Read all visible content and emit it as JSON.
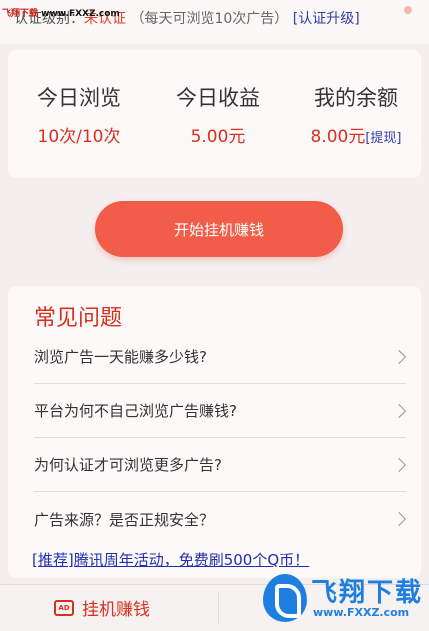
{
  "watermark": {
    "top_brand": "飞翔下载",
    "top_url": "www.FXXZ.com",
    "logo_text": "飞翔下载",
    "logo_url": "www.FXXZ.com"
  },
  "cert": {
    "label": "认证级别：",
    "status": "未认证",
    "note": "（每天可浏览10次广告）",
    "upgrade": "[认证升级]"
  },
  "stats": [
    {
      "label": "今日浏览",
      "value": "10次/10次"
    },
    {
      "label": "今日收益",
      "value": "5.00元"
    },
    {
      "label": "我的余额",
      "value": "8.00元",
      "link": "[提现]"
    }
  ],
  "start_button": "开始挂机赚钱",
  "faq": {
    "title": "常见问题",
    "items": [
      "浏览广告一天能赚多少钱?",
      "平台为何不自己浏览广告赚钱?",
      "为何认证才可浏览更多广告?",
      "广告来源？是否正规安全？"
    ]
  },
  "promo": "[推荐]腾讯周年活动，免费刷500个Q币！",
  "bottom_nav": {
    "tab_label": "挂机赚钱",
    "tab_icon": "tv-ad-icon",
    "tab_icon_text": "AD"
  },
  "colors": {
    "accent": "#f15d49",
    "accent_text": "#d8301f",
    "link": "#2d3fa8"
  }
}
